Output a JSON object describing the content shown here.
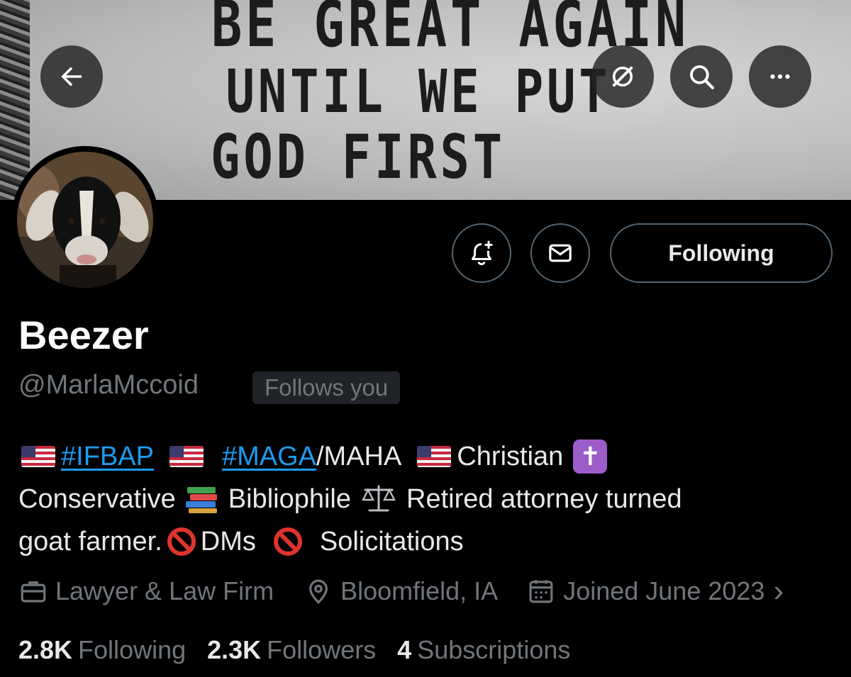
{
  "banner": {
    "sign_lines": [
      "BE GREAT AGAIN",
      "UNTIL WE PUT",
      "GOD FIRST"
    ]
  },
  "nav": {
    "back_icon": "arrow-left-icon",
    "grok_icon": "slashed-circle-icon",
    "search_icon": "search-icon",
    "more_icon": "more-horizontal-icon"
  },
  "actions": {
    "notify_icon": "bell-plus-icon",
    "message_icon": "envelope-icon",
    "following_label": "Following"
  },
  "profile": {
    "name": "Beezer",
    "handle": "@MarlaMccoid",
    "follows_you": "Follows you"
  },
  "bio": {
    "hashtag_1": "#IFBAP",
    "hashtag_2": "#MAGA",
    "text_maha": "/MAHA",
    "text_christian": "Christian",
    "cross_glyph": "✝",
    "text_conservative": "Conservative",
    "text_bibliophile": "Bibliophile",
    "text_attorney": "Retired attorney turned",
    "text_goat": "goat farmer.",
    "text_dms": "DMs",
    "text_solicitations": "Solicitations"
  },
  "meta": {
    "category": "Lawyer & Law Firm",
    "location": "Bloomfield, IA",
    "joined": "Joined June 2023",
    "chevron": "›"
  },
  "stats": {
    "following_count": "2.8K",
    "following_label": "Following",
    "followers_count": "2.3K",
    "followers_label": "Followers",
    "subscriptions_count": "4",
    "subscriptions_label": "Subscriptions"
  }
}
